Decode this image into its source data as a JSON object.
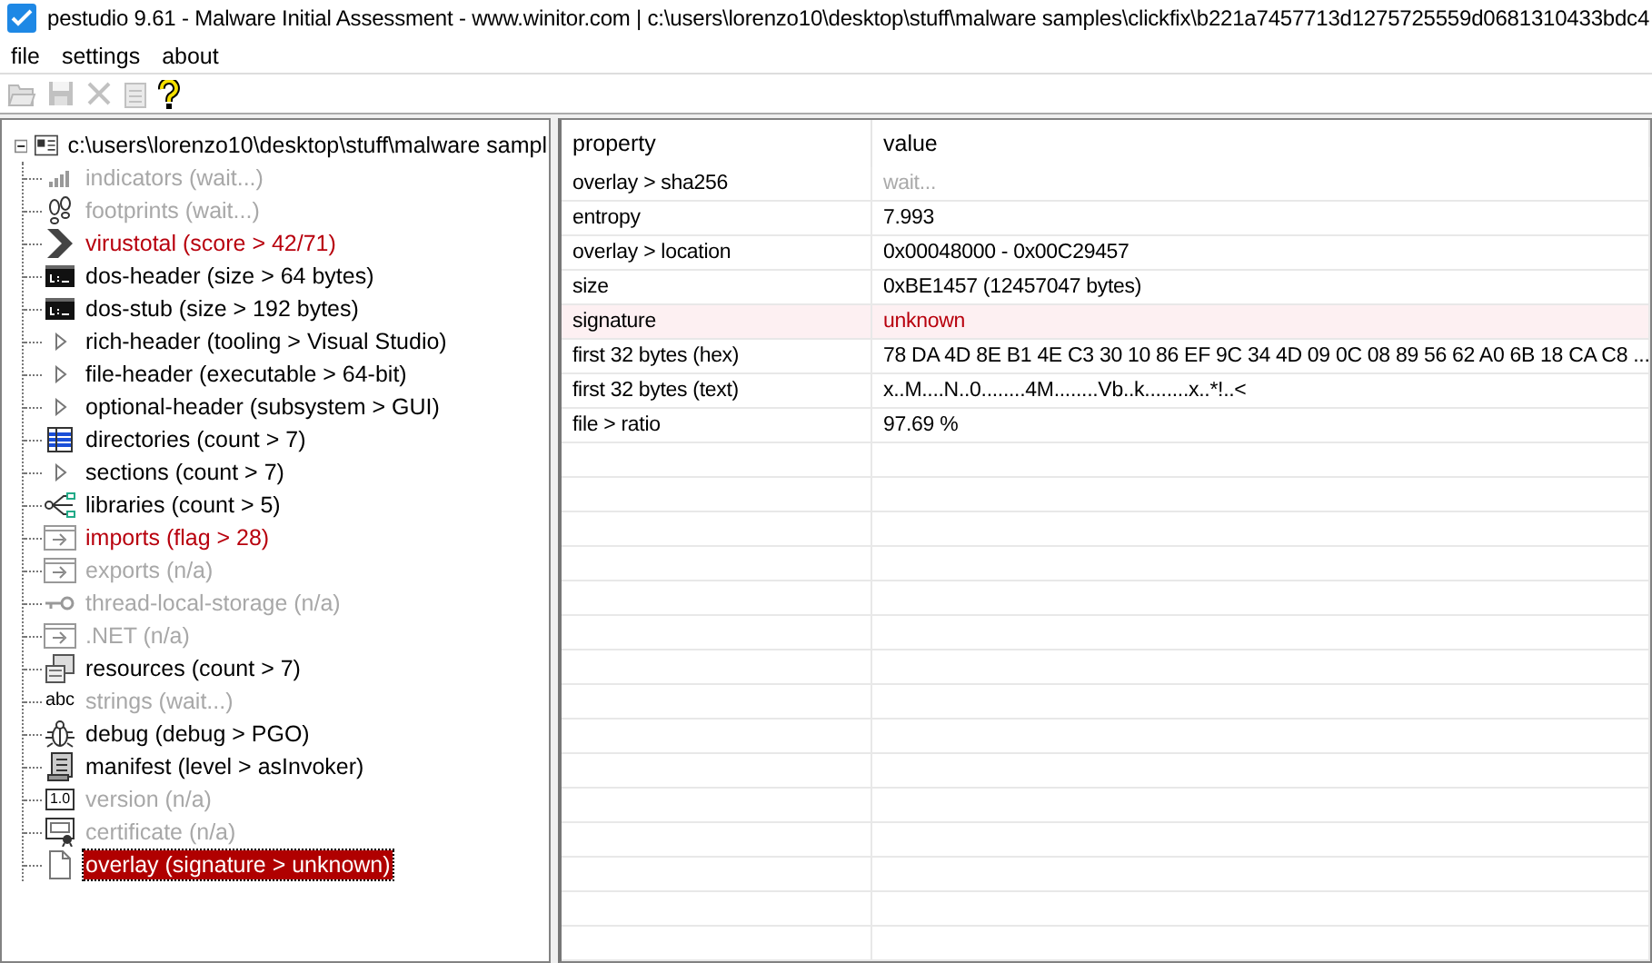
{
  "window": {
    "title": "pestudio 9.61 - Malware Initial Assessment - www.winitor.com | c:\\users\\lorenzo10\\desktop\\stuff\\malware samples\\clickfix\\b221a7457713d1275725559d0681310433bdc4"
  },
  "menu": [
    "file",
    "settings",
    "about"
  ],
  "toolbar": [
    {
      "kind": "open",
      "disabled": true
    },
    {
      "kind": "save",
      "disabled": true
    },
    {
      "kind": "cut",
      "disabled": true
    },
    {
      "kind": "clipboard",
      "disabled": true
    },
    {
      "kind": "help",
      "disabled": false
    }
  ],
  "tree": {
    "label": "c:\\users\\lorenzo10\\desktop\\stuff\\malware sampl",
    "expanded": true,
    "children": [
      {
        "label": "indicators (wait...)",
        "kind": "bars",
        "disabled": true,
        "flagged": false,
        "selected": false
      },
      {
        "label": "footprints (wait...)",
        "kind": "footprints",
        "disabled": true,
        "flagged": false,
        "selected": false
      },
      {
        "label": "virustotal (score > 42/71)",
        "kind": "chevron",
        "disabled": false,
        "flagged": true,
        "selected": false
      },
      {
        "label": "dos-header (size > 64 bytes)",
        "kind": "console",
        "disabled": false,
        "flagged": false,
        "selected": false
      },
      {
        "label": "dos-stub (size > 192 bytes)",
        "kind": "console",
        "disabled": false,
        "flagged": false,
        "selected": false
      },
      {
        "label": "rich-header (tooling > Visual Studio)",
        "kind": "triangle",
        "disabled": false,
        "flagged": false,
        "selected": false
      },
      {
        "label": "file-header (executable > 64-bit)",
        "kind": "triangle",
        "disabled": false,
        "flagged": false,
        "selected": false
      },
      {
        "label": "optional-header (subsystem > GUI)",
        "kind": "triangle",
        "disabled": false,
        "flagged": false,
        "selected": false
      },
      {
        "label": "directories (count > 7)",
        "kind": "grid",
        "disabled": false,
        "flagged": false,
        "selected": false
      },
      {
        "label": "sections (count > 7)",
        "kind": "triangle",
        "disabled": false,
        "flagged": false,
        "selected": false
      },
      {
        "label": "libraries (count > 5)",
        "kind": "branch",
        "disabled": false,
        "flagged": false,
        "selected": false
      },
      {
        "label": "imports (flag > 28)",
        "kind": "window",
        "disabled": false,
        "flagged": true,
        "selected": false
      },
      {
        "label": "exports (n/a)",
        "kind": "window",
        "disabled": true,
        "flagged": false,
        "selected": false
      },
      {
        "label": "thread-local-storage (n/a)",
        "kind": "key",
        "disabled": true,
        "flagged": false,
        "selected": false
      },
      {
        "label": ".NET (n/a)",
        "kind": "window",
        "disabled": true,
        "flagged": false,
        "selected": false
      },
      {
        "label": "resources (count > 7)",
        "kind": "resource",
        "disabled": false,
        "flagged": false,
        "selected": false
      },
      {
        "label": "strings (wait...)",
        "kind": "text",
        "icon_text": "abc",
        "disabled": true,
        "flagged": false,
        "selected": false
      },
      {
        "label": "debug (debug > PGO)",
        "kind": "bug",
        "disabled": false,
        "flagged": false,
        "selected": false
      },
      {
        "label": "manifest (level > asInvoker)",
        "kind": "scroll",
        "disabled": false,
        "flagged": false,
        "selected": false
      },
      {
        "label": "version (n/a)",
        "kind": "boxed",
        "icon_text": "1.0",
        "disabled": true,
        "flagged": false,
        "selected": false
      },
      {
        "label": "certificate (n/a)",
        "kind": "certificate",
        "disabled": true,
        "flagged": false,
        "selected": false
      },
      {
        "label": "overlay (signature > unknown)",
        "kind": "page",
        "disabled": false,
        "flagged": false,
        "selected": true
      }
    ]
  },
  "table": {
    "columns": [
      "property",
      "value"
    ],
    "rows": [
      {
        "property": "overlay > sha256",
        "value": "wait...",
        "disabled": true,
        "flagged": false
      },
      {
        "property": "entropy",
        "value": "7.993",
        "disabled": false,
        "flagged": false
      },
      {
        "property": "overlay > location",
        "value": "0x00048000 - 0x00C29457",
        "disabled": false,
        "flagged": false
      },
      {
        "property": "size",
        "value": "0xBE1457 (12457047 bytes)",
        "disabled": false,
        "flagged": false
      },
      {
        "property": "signature",
        "value": "unknown",
        "disabled": false,
        "flagged": true
      },
      {
        "property": "first 32 bytes (hex)",
        "value": "78 DA 4D 8E B1 4E C3 30 10 86 EF 9C 34 4D 09 0C 08 89 56 62 A0 6B 18 CA C8 ...",
        "disabled": false,
        "flagged": false
      },
      {
        "property": "first 32 bytes (text)",
        "value": "x..M....N..0........4M........Vb..k........x..*!..<",
        "disabled": false,
        "flagged": false
      },
      {
        "property": "file > ratio",
        "value": "97.69 %",
        "disabled": false,
        "flagged": false
      }
    ]
  }
}
